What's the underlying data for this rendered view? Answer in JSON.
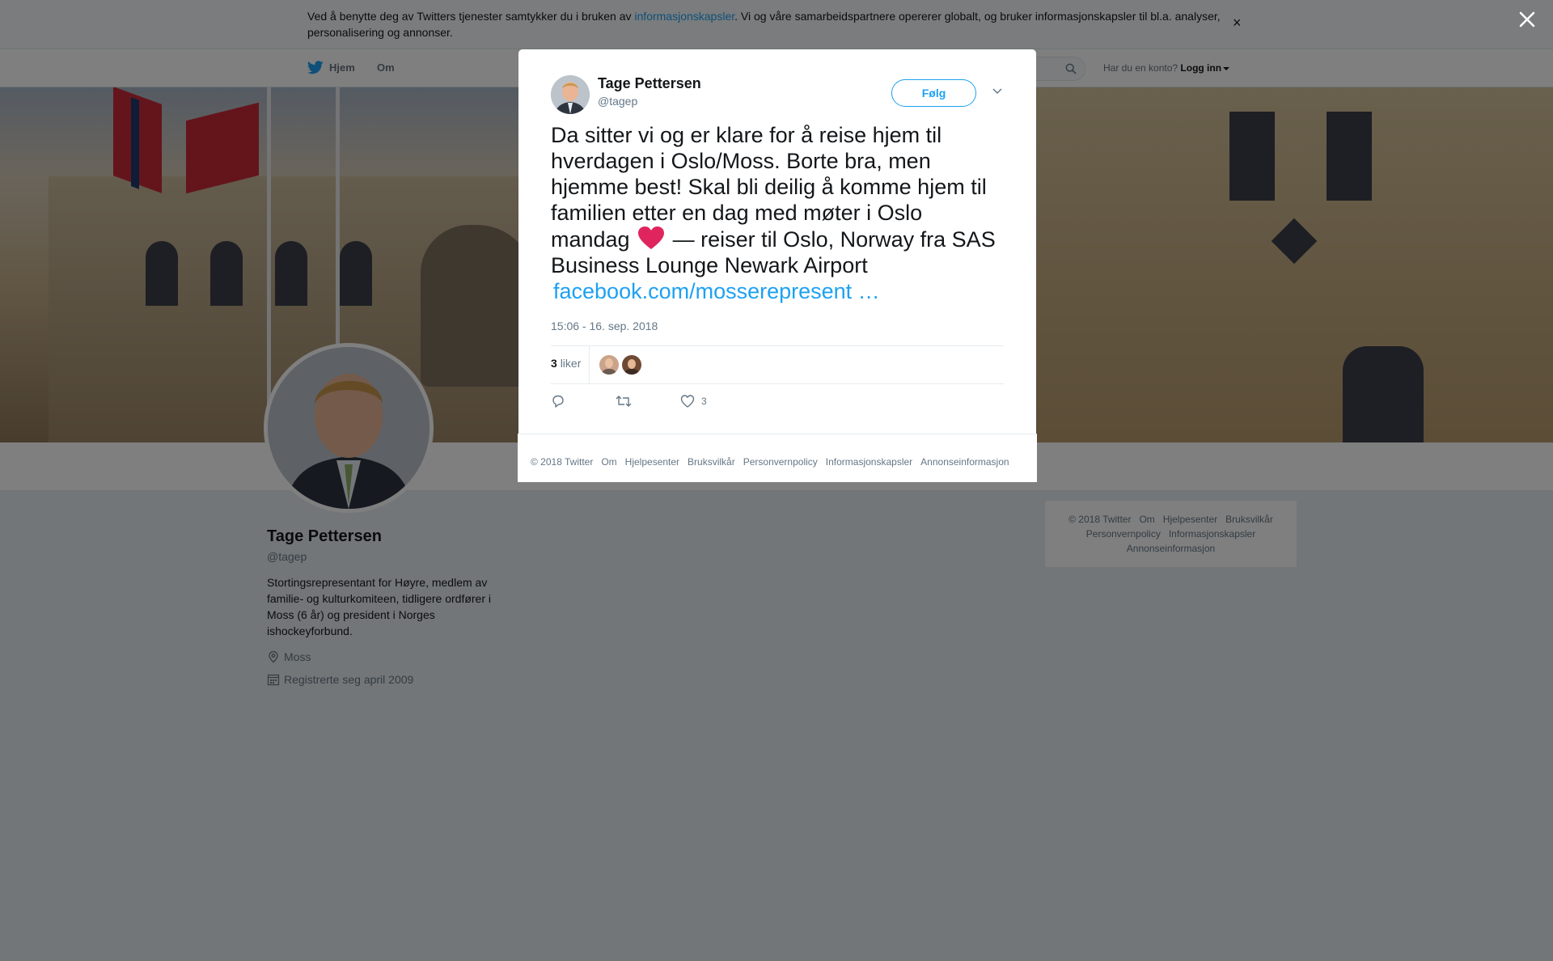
{
  "cookie_bar": {
    "text_before": "Ved å benytte deg av Twitters tjenester samtykker du i bruken av ",
    "link": "informasjonskapsler",
    "text_after": ". Vi og våre samarbeidspartnere opererer globalt, og bruker informasjonskapsler til bl.a. analyser, personalisering og annonser.",
    "close": "×"
  },
  "nav": {
    "home": "Hjem",
    "about": "Om",
    "login_prompt": "Har du en konto?",
    "login": "Logg inn"
  },
  "profile": {
    "name": "Tage Pettersen",
    "handle": "@tagep",
    "bio": "Stortingsrepresentant for Høyre, medlem av familie- og kulturkomiteen, tidligere ordfører i Moss (6 år) og president i Norges ishockeyforbund.",
    "location": "Moss",
    "joined": "Registrerte seg april 2009"
  },
  "side_footer": {
    "items": [
      "© 2018 Twitter",
      "Om",
      "Hjelpesenter",
      "Bruksvilkår",
      "Personvernpolicy",
      "Informasjonskapsler",
      "Annonseinformasjon"
    ]
  },
  "tweet": {
    "author_name": "Tage Pettersen",
    "author_handle": "@tagep",
    "follow_label": "Følg",
    "text_part1": "Da sitter vi og er klare for å reise hjem til hverdagen i Oslo/Moss. Borte bra, men hjemme best! Skal bli deilig å komme hjem til familien etter en dag med møter i Oslo mandag",
    "text_part2": "— reiser til Oslo, Norway fra SAS Business Lounge Newark Airport",
    "link": "facebook.com/mosserepresent …",
    "timestamp": "15:06 - 16. sep. 2018",
    "likes_count": "3",
    "likes_label": "liker",
    "like_action_count": "3"
  },
  "modal_footer": {
    "items": [
      "© 2018 Twitter",
      "Om",
      "Hjelpesenter",
      "Bruksvilkår",
      "Personvernpolicy",
      "Informasjonskapsler",
      "Annonseinformasjon"
    ]
  },
  "colors": {
    "accent": "#1da1f2",
    "heart": "#e0245e"
  }
}
